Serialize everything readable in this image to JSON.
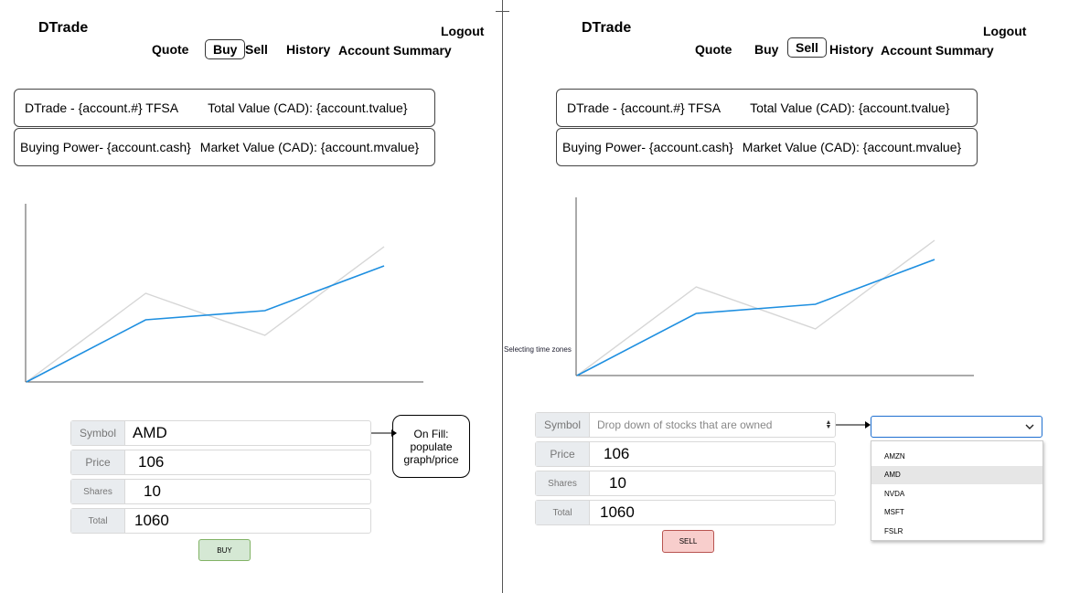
{
  "left_panel": {
    "brand": "DTrade",
    "logout": "Logout",
    "nav": {
      "quote": "Quote",
      "buy": "Buy",
      "sell": "Sell",
      "history": "History",
      "account_summary": "Account Summary"
    },
    "active_tab": "Buy",
    "account_box_1": {
      "account": "DTrade - {account.#} TFSA",
      "total_value": "Total Value (CAD): {account.tvalue}"
    },
    "account_box_2": {
      "buying_power": "Buying Power- {account.cash}",
      "market_value": "Market Value (CAD): {account.mvalue}"
    },
    "form": {
      "symbol_label": "Symbol",
      "symbol_value": "AMD",
      "price_label": "Price",
      "price_value": "106",
      "shares_label": "Shares",
      "shares_value": "10",
      "total_label": "Total",
      "total_value": "1060"
    },
    "buy_button": "BUY",
    "annotation": "On Fill: populate graph/price"
  },
  "right_panel": {
    "brand": "DTrade",
    "logout": "Logout",
    "nav": {
      "quote": "Quote",
      "buy": "Buy",
      "sell": "Sell",
      "history": "History",
      "account_summary": "Account Summary"
    },
    "active_tab": "Sell",
    "account_box_1": {
      "account": "DTrade - {account.#} TFSA",
      "total_value": "Total Value (CAD): {account.tvalue}"
    },
    "account_box_2": {
      "buying_power": "Buying Power- {account.cash}",
      "market_value": "Market Value (CAD): {account.mvalue}"
    },
    "chart_note": "Selecting time zones",
    "form": {
      "symbol_label": "Symbol",
      "symbol_placeholder": "Drop down of stocks that are owned",
      "price_label": "Price",
      "price_value": "106",
      "shares_label": "Shares",
      "shares_value": "10",
      "total_label": "Total",
      "total_value": "1060"
    },
    "sell_button": "SELL",
    "dropdown": {
      "selected": "",
      "options": [
        "AMZN",
        "AMD",
        "NVDA",
        "MSFT",
        "FSLR"
      ],
      "highlighted": "AMD"
    }
  },
  "colors": {
    "series_primary": "#1e8fe0",
    "series_secondary": "#d6d6d6",
    "buy_button_bg": "#d5e8d4",
    "buy_button_border": "#82b366",
    "sell_button_bg": "#f8cecc",
    "sell_button_border": "#b85450",
    "dropdown_border": "#1e6fd0"
  },
  "chart_data": [
    {
      "type": "line",
      "title": "",
      "xlabel": "",
      "ylabel": "",
      "x": [
        0,
        1,
        2,
        3
      ],
      "series": [
        {
          "values": [
            0,
            68,
            78,
            127
          ],
          "color": "#1e8fe0"
        },
        {
          "values": [
            0,
            97,
            51,
            148
          ],
          "color": "#d6d6d6"
        }
      ],
      "ylim": [
        0,
        195
      ],
      "grid": false
    },
    {
      "type": "line",
      "title": "",
      "xlabel": "",
      "ylabel": "",
      "x": [
        0,
        1,
        2,
        3
      ],
      "series": [
        {
          "values": [
            0,
            68,
            78,
            127
          ],
          "color": "#1e8fe0"
        },
        {
          "values": [
            0,
            97,
            51,
            148
          ],
          "color": "#d6d6d6"
        }
      ],
      "ylim": [
        0,
        195
      ],
      "grid": false
    }
  ]
}
